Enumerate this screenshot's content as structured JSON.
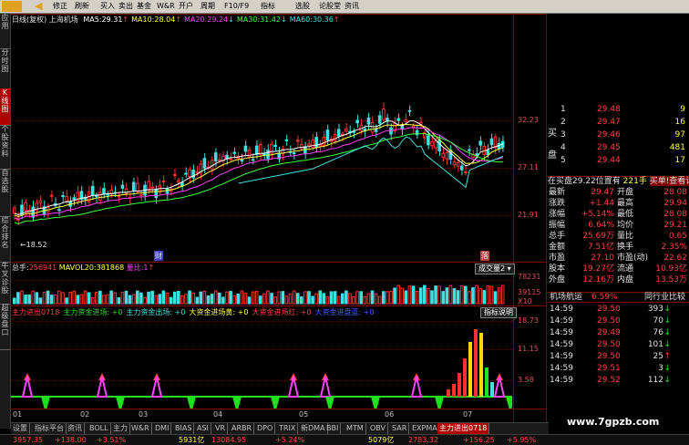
{
  "toolbar": {
    "items": [
      "修正",
      "刷新",
      "买入",
      "卖出",
      "基金",
      "W&R",
      "开户",
      "周期",
      "F10/F9",
      "指标",
      "选股",
      "论股堂",
      "资讯"
    ]
  },
  "left_tabs": [
    {
      "label": "应用",
      "active": false
    },
    {
      "label": "分时图",
      "active": false
    },
    {
      "label": "K线图",
      "active": true
    },
    {
      "label": "个股资料",
      "active": false
    },
    {
      "label": "自选股",
      "active": false
    },
    {
      "label": "综合排名",
      "active": false
    },
    {
      "label": "牛叉诊股",
      "active": false
    },
    {
      "label": "超级盘口",
      "active": false
    }
  ],
  "main_chart": {
    "period_label": "日线(复权)",
    "stock_name": "上海机场",
    "ma": [
      {
        "label": "MA5:",
        "value": "29.31",
        "arrow": "↑",
        "color": "#ffffff"
      },
      {
        "label": "MA10:",
        "value": "28.04",
        "arrow": "↑",
        "color": "#ffff40"
      },
      {
        "label": "MA20:",
        "value": "29.24",
        "arrow": "↓",
        "color": "#ff40ff"
      },
      {
        "label": "MA30:",
        "value": "31.42",
        "arrow": "↓",
        "color": "#40ff40"
      },
      {
        "label": "MA60:",
        "value": "30.36",
        "arrow": "↑",
        "color": "#40e0e0"
      }
    ],
    "y_labels": [
      "32.23",
      "27.11",
      "21.91"
    ],
    "low_label": "←18.52",
    "markers": [
      "财",
      "落"
    ]
  },
  "volume_panel": {
    "total_label": "总手:",
    "total_value": "256941",
    "mavol_label": "MAVOL20:",
    "mavol_value": "381868",
    "ratio_label": "量比:",
    "ratio_value": "1",
    "dropdown": "成交量2",
    "y_labels": [
      "78231",
      "39115",
      "X10"
    ]
  },
  "indicator_panel": {
    "items": [
      {
        "text": "主力进出0718",
        "color": "#ff4040"
      },
      {
        "text": "主力资金进场: +0",
        "color": "#20e020"
      },
      {
        "text": "主力资金出场: +0",
        "color": "#40e0e0"
      },
      {
        "text": "大资金进场黄: +0",
        "color": "#ffff40"
      },
      {
        "text": "大资金进场红: +0",
        "color": "#ff4040"
      },
      {
        "text": "大资金进盘蓝: +0",
        "color": "#4060ff"
      }
    ],
    "help_button": "指标说明",
    "y_labels": [
      "18.73",
      "11.15",
      "3.58"
    ]
  },
  "x_labels": [
    "01",
    "02",
    "03",
    "04",
    "05",
    "06",
    "07"
  ],
  "right_panel": {
    "ask_label": "买",
    "bid_label": "盘",
    "book": [
      {
        "level": "1",
        "price": "29.48",
        "volume": "9"
      },
      {
        "level": "2",
        "price": "29.47",
        "volume": "16"
      },
      {
        "level": "3",
        "price": "29.46",
        "volume": "97"
      },
      {
        "level": "4",
        "price": "29.45",
        "volume": "481"
      },
      {
        "level": "5",
        "price": "29.44",
        "volume": "17"
      }
    ],
    "order_info": "在买盘29.22位置有",
    "order_volume": "221手",
    "order_link": "买单!查看详细",
    "stats": [
      {
        "l1": "最新",
        "v1": "29.47",
        "l2": "开盘",
        "v2": "28.08"
      },
      {
        "l1": "涨跌",
        "v1": "+1.44",
        "l2": "最高",
        "v2": "29.94"
      },
      {
        "l1": "涨幅",
        "v1": "+5.14%",
        "l2": "最低",
        "v2": "28.08"
      },
      {
        "l1": "振幅",
        "v1": "6.64%",
        "l2": "均价",
        "v2": "29.21"
      },
      {
        "l1": "总手",
        "v1": "25.69万",
        "l2": "量比",
        "v2": "0.65"
      },
      {
        "l1": "金额",
        "v1": "7.51亿",
        "l2": "换手",
        "v2": "2.35%"
      },
      {
        "l1": "市盈",
        "v1": "27.10",
        "l2": "市盈(动)",
        "v2": "22.62"
      },
      {
        "l1": "股本",
        "v1": "19.27亿",
        "l2": "流通",
        "v2": "10.93亿"
      },
      {
        "l1": "外盘",
        "v1": "12.16万",
        "l2": "内盘",
        "v2": "13.53万"
      }
    ],
    "sector": "机场航运",
    "sector_change": "6.59%",
    "compare_link": "同行业比较",
    "ticks": [
      {
        "time": "14:59",
        "price": "29.50",
        "volume": "393",
        "dir": "↓"
      },
      {
        "time": "14:59",
        "price": "29.50",
        "volume": "70",
        "dir": "↓"
      },
      {
        "time": "14:59",
        "price": "29.49",
        "volume": "76",
        "dir": "↓"
      },
      {
        "time": "14:59",
        "price": "29.50",
        "volume": "101",
        "dir": "↓"
      },
      {
        "time": "14:59",
        "price": "29.50",
        "volume": "25",
        "dir": "↑"
      },
      {
        "time": "14:59",
        "price": "29.51",
        "volume": "3",
        "dir": "↓"
      },
      {
        "time": "14:59",
        "price": "29.52",
        "volume": "112",
        "dir": "↓"
      }
    ]
  },
  "bottom_tabs": [
    {
      "label": "设置",
      "active": false
    },
    {
      "label": "指标平台",
      "active": false
    },
    {
      "label": "资讯",
      "active": false
    },
    {
      "label": "BOLL",
      "active": false
    },
    {
      "label": "主力",
      "active": false
    },
    {
      "label": "W&R",
      "active": false
    },
    {
      "label": "DMI",
      "active": false
    },
    {
      "label": "BIAS",
      "active": false
    },
    {
      "label": "ASI",
      "active": false
    },
    {
      "label": "VR",
      "active": false
    },
    {
      "label": "ARBR",
      "active": false
    },
    {
      "label": "DPO",
      "active": false
    },
    {
      "label": "TRIX",
      "active": false
    },
    {
      "label": "新DMA",
      "active": false
    },
    {
      "label": "BBI",
      "active": false
    },
    {
      "label": "MTM",
      "active": false
    },
    {
      "label": "OBV",
      "active": false
    },
    {
      "label": "SAR",
      "active": false
    },
    {
      "label": "EXPMA",
      "active": false
    },
    {
      "label": "主力进出0718",
      "active": true
    }
  ],
  "status_bar": [
    {
      "text": "3957.35",
      "color": "#ff4040"
    },
    {
      "text": "+138.00",
      "color": "#ff4040"
    },
    {
      "text": "+3.51%",
      "color": "#ff4040"
    },
    {
      "text": "5931亿",
      "color": "#ffff40"
    },
    {
      "text": "13084.95",
      "color": "#ff4040"
    },
    {
      "text": "+5.24%",
      "color": "#ff4040"
    },
    {
      "text": "5079亿",
      "color": "#ffff40"
    },
    {
      "text": "2783.32",
      "color": "#ff4040"
    },
    {
      "text": "+156.25",
      "color": "#ff4040"
    },
    {
      "text": "+5.95%",
      "color": "#ff4040"
    }
  ],
  "watermark": "www.7gpzb.com"
}
